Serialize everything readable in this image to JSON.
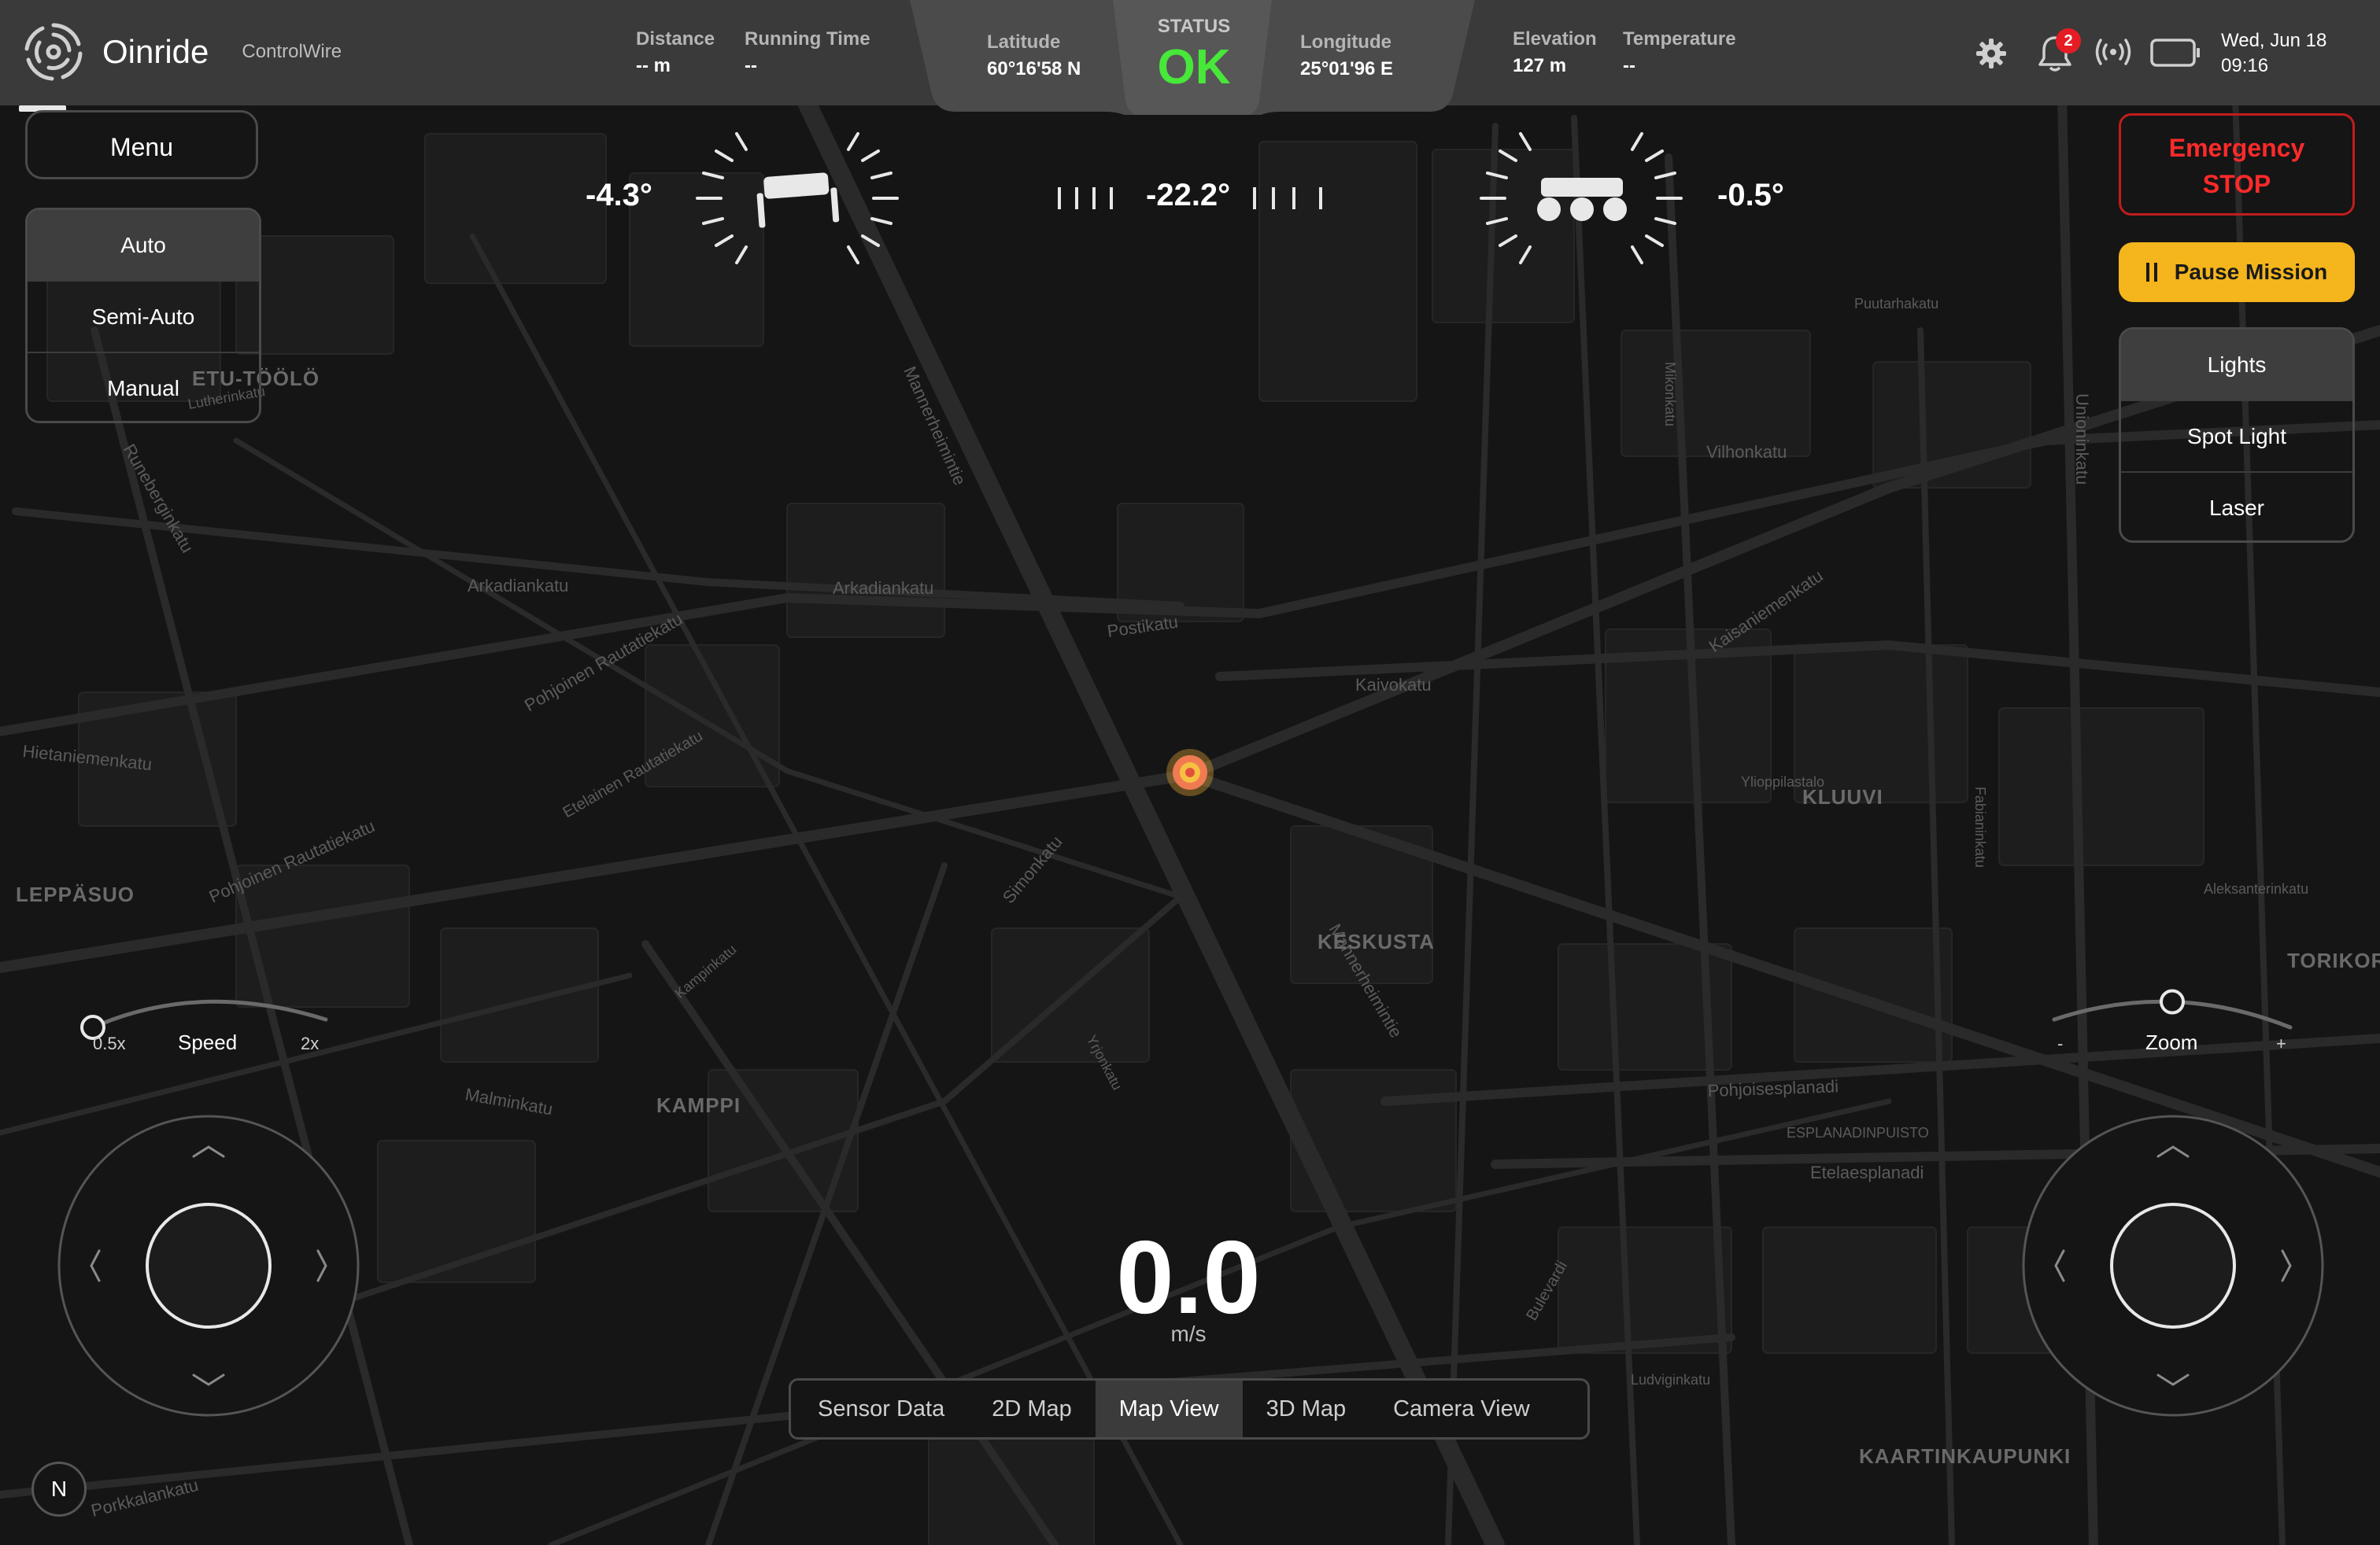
{
  "app": {
    "name": "Oinride",
    "subtitle": "ControlWire"
  },
  "telemetry": {
    "distance": {
      "label": "Distance",
      "value": "-- m"
    },
    "running_time": {
      "label": "Running Time",
      "value": "--"
    },
    "latitude": {
      "label": "Latitude",
      "value": "60°16'58 N"
    },
    "status": {
      "label": "STATUS",
      "value": "OK"
    },
    "longitude": {
      "label": "Longitude",
      "value": "25°01'96 E"
    },
    "elevation": {
      "label": "Elevation",
      "value": "127 m"
    },
    "temperature": {
      "label": "Temperature",
      "value": "--"
    }
  },
  "header": {
    "notification_count": "2",
    "date": "Wed, Jun 18",
    "time": "09:16"
  },
  "menu": {
    "label": "Menu"
  },
  "modes": [
    {
      "label": "Auto",
      "active": true
    },
    {
      "label": "Semi-Auto",
      "active": false
    },
    {
      "label": "Manual",
      "active": false
    }
  ],
  "actions": {
    "emergency_line1": "Emergency",
    "emergency_line2": "STOP",
    "pause": "Pause Mission"
  },
  "lights": [
    {
      "label": "Lights",
      "active": true
    },
    {
      "label": "Spot Light",
      "active": false
    },
    {
      "label": "Laser",
      "active": false
    }
  ],
  "attitude": {
    "roll": "-4.3°",
    "heading": "-22.2°",
    "pitch": "-0.5°"
  },
  "speed": {
    "value": "0.0",
    "unit": "m/s"
  },
  "speed_slider": {
    "title": "Speed",
    "min_label": "0.5x",
    "max_label": "2x",
    "level": 0.0
  },
  "zoom_slider": {
    "title": "Zoom",
    "min_label": "-",
    "max_label": "+",
    "level": 0.5
  },
  "views": [
    {
      "label": "Sensor Data",
      "active": false
    },
    {
      "label": "2D Map",
      "active": false
    },
    {
      "label": "Map View",
      "active": true
    },
    {
      "label": "3D Map",
      "active": false
    },
    {
      "label": "Camera View",
      "active": false
    }
  ],
  "compass": {
    "label": "N"
  },
  "map": {
    "districts": [
      "ETU-TÖÖLÖ",
      "LEPPÄSUO",
      "KAMPPI",
      "KESKUSTA",
      "KLUUVI",
      "KAARTINKAUPUNKI",
      "TORIKOR"
    ],
    "streets": [
      "Arkadiankatu",
      "Arkadiankatu",
      "Postikatu",
      "Kaivokatu",
      "Vilhonkatu",
      "Mannerheimintie",
      "Pohjoinen Rautatiekatu",
      "Hietaniemenkatu",
      "Pohjoinen Rautatiekatu",
      "Runeberginkatu",
      "Simonkatu",
      "Malminkatu",
      "Pohjoisesplanadi",
      "Etelaesplanadi",
      "ESPLANADINPUISTO",
      "Porkkalankatu",
      "Aleksanterinkatu",
      "Unioninkatu",
      "Kaisaniemenkatu",
      "Mannerheimintie",
      "Puutarhakatu",
      "Ylioppilastalo",
      "Lutherinkatu",
      "Kampinkatu",
      "Yrjonkatu",
      "Bulevardi",
      "Ludviginkatu",
      "Etelainen Rautatiekatu",
      "Fabianinkatu",
      "Mikonkatu"
    ],
    "marker_color": "#f5b53a"
  },
  "colors": {
    "accent": "#f4b51d",
    "danger": "#ff2a2a",
    "ok": "#47e83a"
  }
}
